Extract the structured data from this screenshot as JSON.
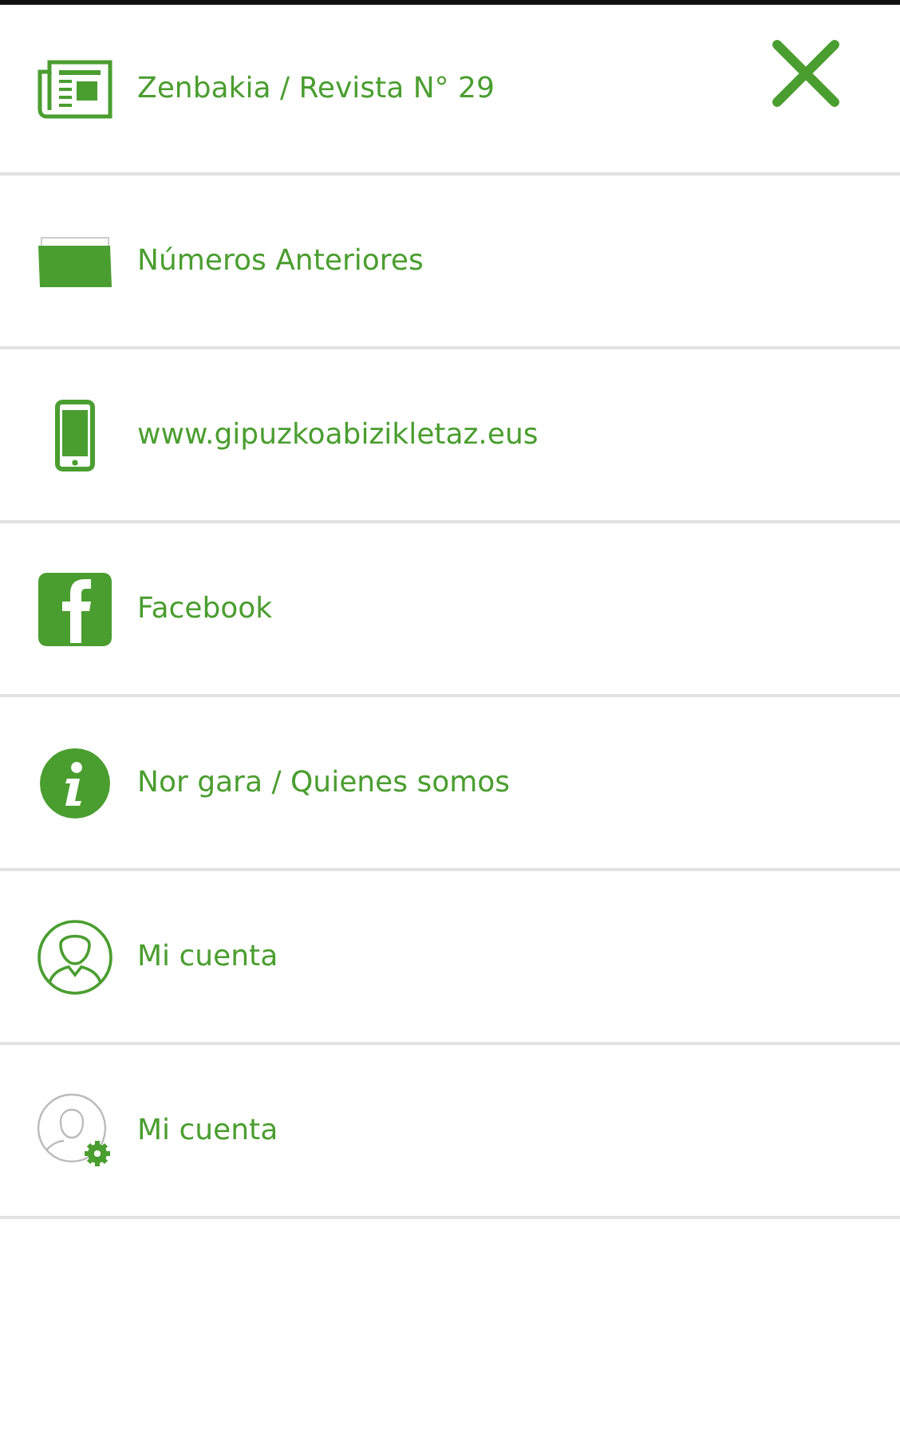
{
  "menu": {
    "items": [
      {
        "label": "Zenbakia / Revista N° 29"
      },
      {
        "label": "Números Anteriores"
      },
      {
        "label": "www.gipuzkoabizikletaz.eus"
      },
      {
        "label": "Facebook"
      },
      {
        "label": "Nor gara / Quienes somos"
      },
      {
        "label": "Mi cuenta"
      },
      {
        "label": "Mi cuenta"
      }
    ]
  }
}
